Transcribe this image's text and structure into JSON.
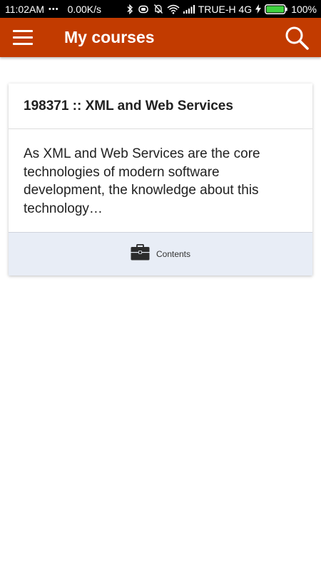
{
  "status_bar": {
    "time": "11:02AM",
    "dots": "•••",
    "net_speed": "0.00K/s",
    "carrier": "TRUE-H 4G",
    "battery_percent": "100%",
    "battery_level": 1.0,
    "icons": [
      "bluetooth-icon",
      "vibrate-icon",
      "notifications-off-icon",
      "wifi-icon",
      "signal-icon",
      "charging-icon",
      "battery-icon"
    ]
  },
  "app_bar": {
    "title": "My courses",
    "color": "#c23b00",
    "menu_icon": "menu-icon",
    "search_icon": "search-icon"
  },
  "course_card": {
    "title": "198371 :: XML and Web Services",
    "summary": "As XML and Web Services are the core technologies of modern software development, the knowledge about this technology…",
    "footer_label": "Contents",
    "footer_icon": "briefcase-icon",
    "footer_color": "#e8edf6"
  }
}
